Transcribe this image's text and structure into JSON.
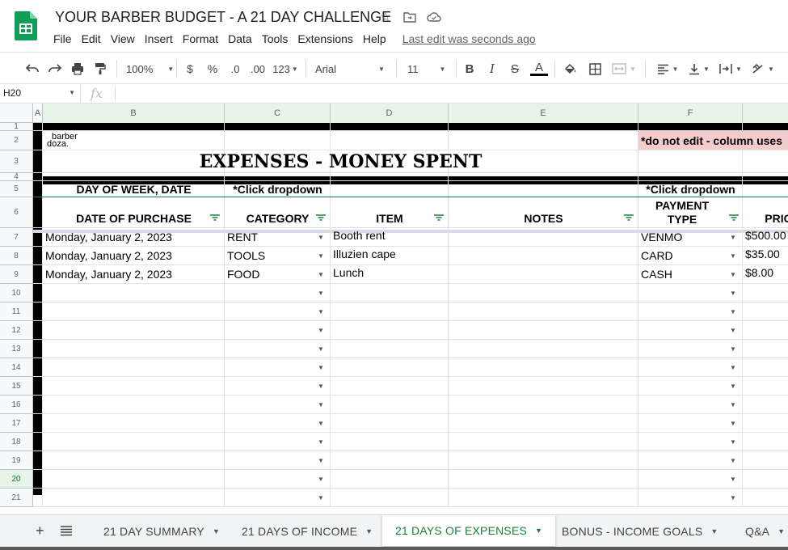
{
  "window": {
    "title": "YOUR BARBER BUDGET - A 21 DAY CHALLENGE",
    "last_edit": "Last edit was seconds ago"
  },
  "menu": [
    "File",
    "Edit",
    "View",
    "Insert",
    "Format",
    "Data",
    "Tools",
    "Extensions",
    "Help"
  ],
  "toolbar": {
    "zoom": "100%",
    "currency": "$",
    "percent": "%",
    "decrease_decimal": ".0",
    "increase_decimal": ".00",
    "number_format": "123",
    "font": "Arial",
    "font_size": "11",
    "bold": "B",
    "italic": "I",
    "strike": "S",
    "text_color": "A"
  },
  "formula_bar": {
    "cell_ref": "H20",
    "fx": "fx",
    "value": ""
  },
  "columns": [
    "A",
    "B",
    "C",
    "D",
    "E",
    "F"
  ],
  "rows": [
    "1",
    "2",
    "3",
    "4",
    "5",
    "6",
    "7",
    "8",
    "9",
    "10",
    "11",
    "12",
    "13",
    "14",
    "15",
    "16",
    "17",
    "18",
    "19",
    "20",
    "21"
  ],
  "sheet": {
    "logo_top": "barber",
    "logo_bottom": "doza.",
    "title": "EXPENSES - MONEY SPENT",
    "note_f2": "*do not edit - column uses",
    "hint_b5": "DAY OF WEEK, DATE",
    "hint_c5": "*Click dropdown",
    "hint_f5": "*Click dropdown",
    "headers": {
      "date": "DATE OF PURCHASE",
      "category": "CATEGORY",
      "item": "ITEM",
      "notes": "NOTES",
      "payment_line1": "PAYMENT",
      "payment_line2": "TYPE",
      "price": "PRIC"
    },
    "data_rows": [
      {
        "date": "Monday, January 2, 2023",
        "category": "RENT",
        "item": "Booth rent",
        "notes": "",
        "payment": "VENMO",
        "price": "$500.00"
      },
      {
        "date": "Monday, January 2, 2023",
        "category": "TOOLS",
        "item": "Illuzien cape",
        "notes": "",
        "payment": "CARD",
        "price": "$35.00"
      },
      {
        "date": "Monday, January 2, 2023",
        "category": "FOOD",
        "item": "Lunch",
        "notes": "",
        "payment": "CASH",
        "price": "$8.00"
      }
    ]
  },
  "tabs": [
    {
      "label": "21 DAY SUMMARY",
      "active": false
    },
    {
      "label": "21 DAYS OF INCOME",
      "active": false
    },
    {
      "label": "21 DAYS OF EXPENSES",
      "active": true
    },
    {
      "label": "BONUS - INCOME GOALS",
      "active": false
    },
    {
      "label": "Q&A",
      "active": false
    }
  ],
  "colors": {
    "accent_green": "#188038",
    "note_pink": "#f4cccc",
    "selected_header": "#e6f4ea"
  }
}
